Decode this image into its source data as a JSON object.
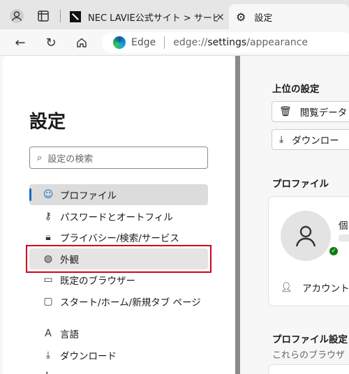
{
  "browser": {
    "tabs": [
      {
        "title": "NEC LAVIE公式サイト > サービス&サ",
        "active": false
      },
      {
        "title": "設定",
        "active": true
      }
    ],
    "address": {
      "brand": "Edge",
      "url_prefix": "edge://",
      "url_host": "settings",
      "url_path": "/appearance"
    },
    "icons": {
      "close_tab": "×"
    }
  },
  "sidebar": {
    "title": "設定",
    "search_placeholder": "設定の検索",
    "items": [
      {
        "label": "プロファイル",
        "icon": "profile-icon",
        "state": "active"
      },
      {
        "label": "パスワードとオートフィル",
        "icon": "key-icon",
        "state": ""
      },
      {
        "label": "プライバシー/検索/サービス",
        "icon": "lock-icon",
        "state": ""
      },
      {
        "label": "外観",
        "icon": "palette-icon",
        "state": "highlighted"
      },
      {
        "label": "既定のブラウザー",
        "icon": "browser-icon",
        "state": ""
      },
      {
        "label": "スタート/ホーム/新規タブ ページ",
        "icon": "home-tab-icon",
        "state": ""
      },
      {
        "label": "言語",
        "icon": "language-icon",
        "state": ""
      },
      {
        "label": "ダウンロード",
        "icon": "download-icon",
        "state": ""
      },
      {
        "label": "",
        "icon": "accessibility-icon",
        "state": ""
      }
    ]
  },
  "main": {
    "top_settings": {
      "heading": "上位の設定",
      "buttons": [
        {
          "label": "閲覧データ",
          "icon": "trash-icon"
        },
        {
          "label": "ダウンロー",
          "icon": "download-icon"
        }
      ]
    },
    "profile": {
      "heading": "プロファイル",
      "name": "個",
      "account_label": "アカウント"
    },
    "profile_settings": {
      "heading": "プロファイル設定",
      "subtext": "これらのブラウザ"
    }
  },
  "colors": {
    "accent": "#0f6cbd",
    "highlight_box": "#d0021b",
    "status_ok": "#107c10"
  }
}
